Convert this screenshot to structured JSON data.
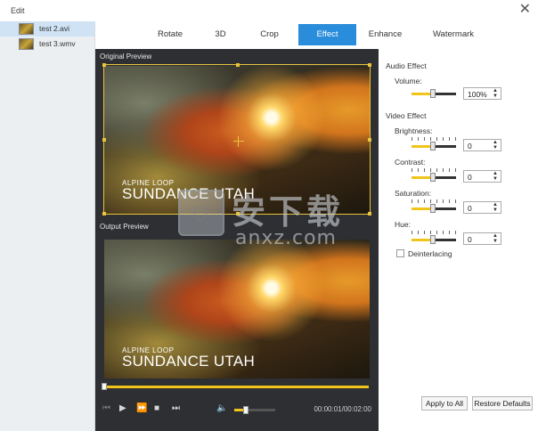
{
  "window": {
    "title": "Edit",
    "close_icon": "close-icon"
  },
  "files": [
    {
      "name": "test 2.avi",
      "selected": true
    },
    {
      "name": "test 3.wmv",
      "selected": false
    }
  ],
  "tabs": [
    {
      "label": "Rotate",
      "active": false
    },
    {
      "label": "3D",
      "active": false
    },
    {
      "label": "Crop",
      "active": false
    },
    {
      "label": "Effect",
      "active": true
    },
    {
      "label": "Enhance",
      "active": false
    },
    {
      "label": "Watermark",
      "active": false
    }
  ],
  "preview": {
    "original_label": "Original Preview",
    "output_label": "Output Preview",
    "caption_small": "ALPINE LOOP",
    "caption_big": "SUNDANCE UTAH",
    "timecode": "00:00:01/00:02:00",
    "seek_progress": 0.02,
    "volume_level": 0.3
  },
  "settings": {
    "audio_effect_title": "Audio Effect",
    "volume_label": "Volume:",
    "volume_value": "100%",
    "video_effect_title": "Video Effect",
    "brightness_label": "Brightness:",
    "brightness_value": "0",
    "contrast_label": "Contrast:",
    "contrast_value": "0",
    "saturation_label": "Saturation:",
    "saturation_value": "0",
    "hue_label": "Hue:",
    "hue_value": "0",
    "deinterlacing_label": "Deinterlacing",
    "deinterlacing_checked": false,
    "apply_to_all_label": "Apply to All",
    "restore_defaults_label": "Restore Defaults"
  },
  "watermark": {
    "big_text": "安下载",
    "small_text": "anxz.com"
  },
  "colors": {
    "accent": "#2a8ddb",
    "slider_fill": "#f0c419",
    "preview_bg": "#2d2f33"
  }
}
